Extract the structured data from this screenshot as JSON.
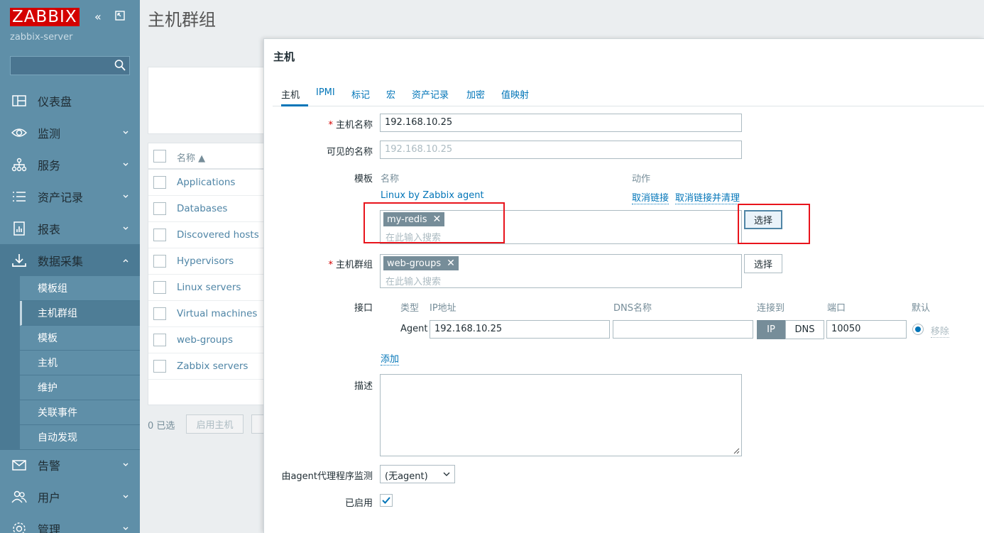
{
  "sidebar": {
    "logo": "ZABBIX",
    "server": "zabbix-server",
    "menu": [
      {
        "label": "仪表盘"
      },
      {
        "label": "监测"
      },
      {
        "label": "服务"
      },
      {
        "label": "资产记录"
      },
      {
        "label": "报表"
      },
      {
        "label": "数据采集"
      },
      {
        "label": "告警"
      },
      {
        "label": "用户"
      },
      {
        "label": "管理"
      }
    ],
    "submenu": [
      "模板组",
      "主机群组",
      "模板",
      "主机",
      "维护",
      "关联事件",
      "自动发现"
    ]
  },
  "page": {
    "title": "主机群组",
    "list_header": "名称",
    "rows": [
      "Applications",
      "Databases",
      "Discovered hosts",
      "Hypervisors",
      "Linux servers",
      "Virtual machines",
      "web-groups",
      "Zabbix servers"
    ],
    "selected_count": "0 已选",
    "enable_button": "启用主机"
  },
  "modal": {
    "title": "主机",
    "tabs": [
      "主机",
      "IPMI",
      "标记",
      "宏",
      "资产记录",
      "加密",
      "值映射"
    ],
    "host_name_label": "主机名称",
    "host_name_value": "192.168.10.25",
    "visible_name_label": "可见的名称",
    "visible_name_placeholder": "192.168.10.25",
    "templates_label": "模板",
    "templates_col_name": "名称",
    "templates_col_action": "动作",
    "linked_template": "Linux by Zabbix agent",
    "unlink": "取消链接",
    "unlink_clear": "取消链接并清理",
    "template_chip": "my-redis",
    "search_placeholder": "在此输入搜索",
    "select_button": "选择",
    "groups_label": "主机群组",
    "group_chip": "web-groups",
    "interfaces_label": "接口",
    "iface_type": "类型",
    "iface_ip": "IP地址",
    "iface_dns": "DNS名称",
    "iface_connect": "连接到",
    "iface_port": "端口",
    "iface_default": "默认",
    "iface_agent": "Agent",
    "iface_ip_value": "192.168.10.25",
    "iface_ip_btn": "IP",
    "iface_dns_btn": "DNS",
    "iface_port_value": "10050",
    "iface_remove": "移除",
    "add": "添加",
    "description_label": "描述",
    "proxy_label": "由agent代理程序监测",
    "proxy_value": "(无agent)",
    "enabled_label": "已启用"
  }
}
